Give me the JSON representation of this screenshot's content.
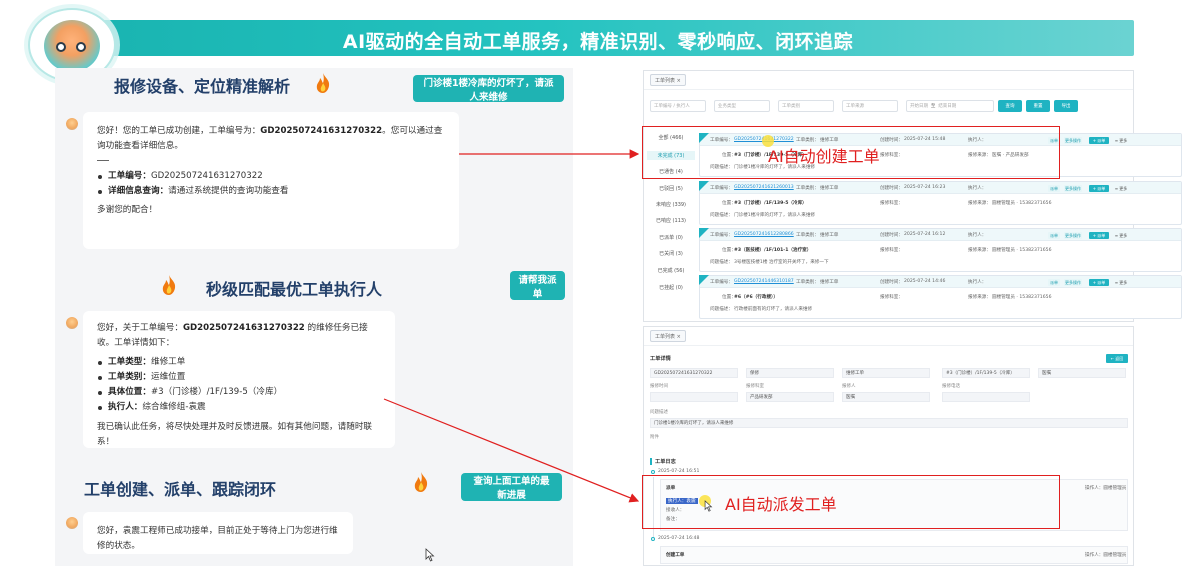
{
  "banner": {
    "title": "AI驱动的全自动工单服务，精准识别、零秒响应、闭环追踪"
  },
  "left": {
    "sections": [
      {
        "title": "报修设备、定位精准解析",
        "button": "门诊楼1楼冷库的灯坏了，请派人来维修"
      },
      {
        "title": "秒级匹配最优工单执行人",
        "button": "请帮我派单"
      },
      {
        "title": "工单创建、派单、跟踪闭环",
        "button": "查询上面工单的最新进展"
      }
    ],
    "msg1": {
      "intro_pre": "您好！您的工单已成功创建，工单编号为：",
      "order_no": "GD202507241631270322",
      "intro_post": "。您可以通过查询功能查看详细信息。",
      "items": [
        {
          "label": "工单编号：",
          "value": "GD202507241631270322"
        },
        {
          "label": "详细信息查询：",
          "value": "请通过系统提供的查询功能查看"
        }
      ],
      "closing": "多谢您的配合！"
    },
    "msg2": {
      "intro_pre": "您好，关于工单编号：",
      "order_no": "GD202507241631270322",
      "intro_post": " 的维修任务已接收。工单详情如下：",
      "items": [
        {
          "label": "工单类型：",
          "value": "维修工单"
        },
        {
          "label": "工单类别：",
          "value": "运维位置"
        },
        {
          "label": "具体位置：",
          "value": "#3（门诊楼）/1F/139-5（冷库）"
        },
        {
          "label": "执行人：",
          "value": "综合维修组-袁震"
        }
      ],
      "closing": "我已确认此任务，将尽快处理并及时反馈进展。如有其他问题，请随时联系！"
    },
    "msg3": {
      "text": "您好，袁震工程师已成功接单，目前正处于等待上门为您进行维修的状态。"
    }
  },
  "list_shot": {
    "tab": "工单列表 ×",
    "filters": [
      "工单编号 / 执行人",
      "业务类型",
      "工单类别",
      "工单来源",
      "开始日期",
      "至",
      "结束日期"
    ],
    "buttons": [
      "查询",
      "重置",
      "导出"
    ],
    "side": [
      "全部 (466)",
      "未完成 (73)",
      "已通告 (4)",
      "已驳回 (5)",
      "未响应 (339)",
      "已响应 (113)",
      "已派单 (0)",
      "已关闭 (3)",
      "已完成 (56)",
      "已挂起 (0)"
    ],
    "cards": [
      {
        "no": "GD202507241631270322",
        "type": "维修工单",
        "time": "2025-07-24 15:48",
        "loc": "#3（门诊楼）/1F/139-5（冷库）",
        "desc": "门诊楼1楼冷库的灯坏了，请派人来维修",
        "source": "医嘱 · 产品研发部"
      },
      {
        "no": "GD202507241621260013",
        "type": "维修工单",
        "time": "2025-07-24 16:23",
        "loc": "#3（门诊楼）/1F/139-5（冷库）",
        "desc": "门诊楼1楼冷库的灯坏了，请派人来维修",
        "source": "圆楼管理员 · 15382371656"
      },
      {
        "no": "GD202507241612280866",
        "type": "维修工单",
        "time": "2025-07-24 16:12",
        "loc": "#3（医技楼）/1F/101-1（治疗室）",
        "desc": "3号楼医技楼1楼 治疗室的开关坏了，来修一下",
        "source": "圆楼管理员 · 15382371656"
      },
      {
        "no": "GD202507241446310187",
        "type": "维修工单",
        "time": "2025-07-24 14:46",
        "loc": "#6（#6（行政楼））",
        "desc": "行政楼前面有的灯坏了，请派人来维修",
        "source": "圆楼管理员 · 15382371656"
      }
    ],
    "card_labels": {
      "no": "工单编号：",
      "type": "工单类别：",
      "time": "创建时间：",
      "exec": "执行人：",
      "loc": "位置：",
      "desc": "问题描述：",
      "src": "报修来源：",
      "dept": "报修科室："
    },
    "card_buttons": [
      "派单",
      "更多操作",
      "+ 派单",
      "≡ 更多"
    ]
  },
  "detail_shot": {
    "tab": "工单列表 ×",
    "title": "工单详情",
    "back": "← 返回",
    "row1": [
      "GD202507241631270322",
      "保修",
      "维修工单",
      "#3（门诊楼）/1F/139-5（冷库）",
      "医嘱"
    ],
    "labels2": [
      "报修时间",
      "报修科室",
      "报修人",
      "报修电话"
    ],
    "row2": [
      "",
      "产品研发部",
      "医嘱",
      ""
    ],
    "desc_label": "问题描述",
    "desc": "门诊楼1楼冷库的灯坏了，请派人来维修",
    "attach_label": "附件",
    "log_title": "工单日志",
    "log1_time": "2025-07-24 16:51",
    "log1_title": "派单",
    "log1_lines": [
      "执行人：袁震",
      "接收人：",
      "备注："
    ],
    "log1_op": "操作人：圆楼管理员",
    "log2_time": "2025-07-24 16:48",
    "log2_title": "创建工单",
    "log2_op": "操作人：圆楼管理员"
  },
  "callouts": {
    "create": "AI自动创建工单",
    "dispatch": "AI自动派发工单"
  },
  "colors": {
    "teal": "#1fb3b3",
    "red": "#e02020",
    "title": "#23406a"
  }
}
